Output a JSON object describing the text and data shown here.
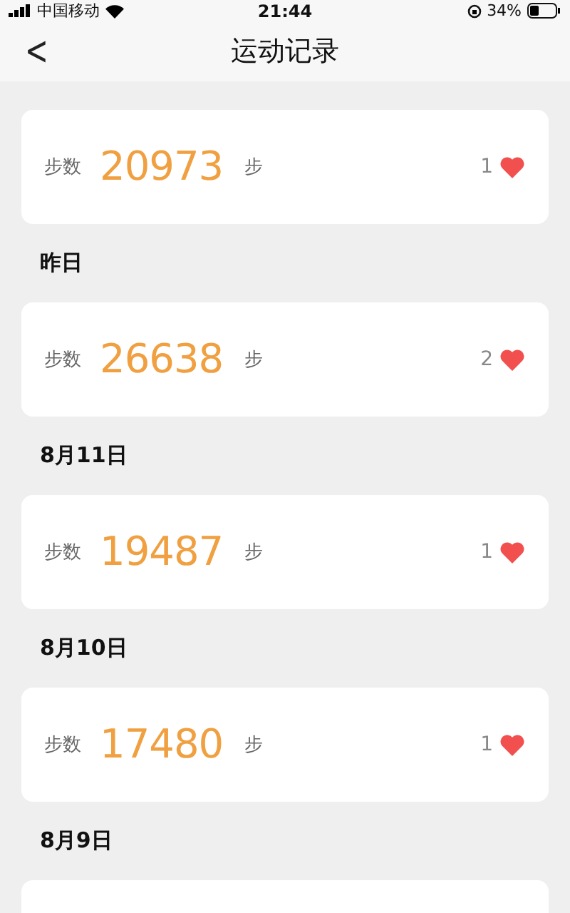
{
  "status_bar": {
    "carrier": "中国移动",
    "time": "21:44",
    "battery": "34%"
  },
  "header": {
    "back": "<",
    "title": "运动记录"
  },
  "days": [
    {
      "label": "步数",
      "steps": "20973",
      "unit": "步",
      "likes": "1"
    },
    {
      "date": "昨日",
      "label": "步数",
      "steps": "26638",
      "unit": "步",
      "likes": "2"
    },
    {
      "date": "8月11日",
      "label": "步数",
      "steps": "19487",
      "unit": "步",
      "likes": "1"
    },
    {
      "date": "8月10日",
      "label": "步数",
      "steps": "17480",
      "unit": "步",
      "likes": "1"
    },
    {
      "date": "8月9日"
    }
  ]
}
